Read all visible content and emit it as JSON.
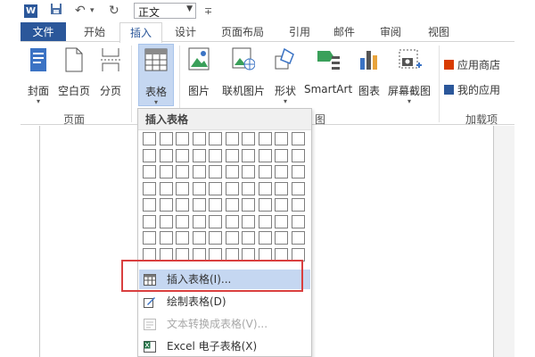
{
  "quick_access": {
    "app_icon": "word-icon",
    "save_icon": "save-icon",
    "undo_icon": "undo-icon",
    "redo_icon": "redo-icon",
    "style_value": "正文",
    "customize_icon": "customize-qat-icon"
  },
  "tabs": [
    "文件",
    "开始",
    "插入",
    "设计",
    "页面布局",
    "引用",
    "邮件",
    "审阅",
    "视图"
  ],
  "ribbon": {
    "buttons": {
      "cover": "封面",
      "blank_page": "空白页",
      "page_break": "分页",
      "table": "表格",
      "picture": "图片",
      "online_picture": "联机图片",
      "shapes": "形状",
      "smartart": "SmartArt",
      "chart": "图表",
      "screenshot": "屏幕截图"
    },
    "groups": {
      "pages": "页面",
      "illustrations_tail": "图",
      "addins": "加载项"
    },
    "addins": {
      "store": "应用商店",
      "my_apps": "我的应用"
    }
  },
  "dropdown": {
    "header": "插入表格",
    "grid_rows": 8,
    "grid_cols": 10,
    "items": [
      {
        "label": "插入表格(I)...",
        "highlighted": true,
        "disabled": false,
        "icon": "insert-table-icon"
      },
      {
        "label": "绘制表格(D)",
        "highlighted": false,
        "disabled": false,
        "icon": "draw-table-icon"
      },
      {
        "label": "文本转换成表格(V)...",
        "highlighted": false,
        "disabled": true,
        "icon": "convert-text-table-icon"
      },
      {
        "label": "Excel 电子表格(X)",
        "highlighted": false,
        "disabled": false,
        "icon": "excel-sheet-icon"
      }
    ]
  },
  "colors": {
    "file_tab": "#2b579a",
    "highlight": "#c5d7f1",
    "annotation_box": "#d93f3f"
  }
}
